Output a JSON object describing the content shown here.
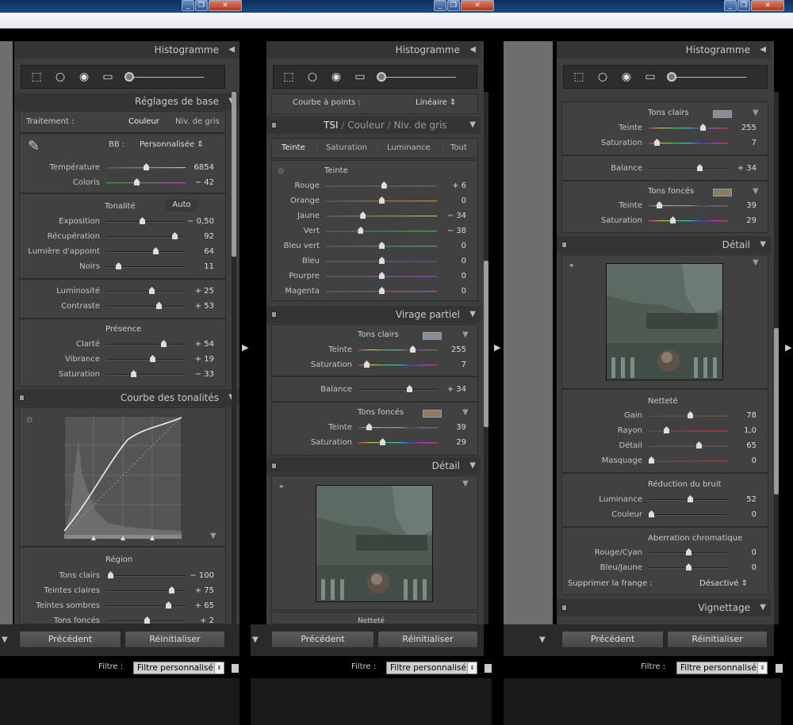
{
  "window": {
    "min": "_",
    "restore": "❐",
    "close": "✕"
  },
  "histogram": {
    "title": "Histogramme"
  },
  "panel1": {
    "basic": {
      "title": "Réglages de base",
      "traitement_label": "Traitement :",
      "couleur": "Couleur",
      "gris": "Niv. de gris",
      "bb_label": "BB :",
      "bb_value": "Personnalisée ⇕"
    },
    "wb": [
      {
        "label": "Température",
        "value": "6854",
        "pos": 0.5
      },
      {
        "label": "Coloris",
        "value": "− 42",
        "pos": 0.38
      }
    ],
    "tonalite": {
      "label": "Tonalité",
      "auto": "Auto"
    },
    "tone": [
      {
        "label": "Exposition",
        "value": "− 0,50",
        "pos": 0.45
      },
      {
        "label": "Récupération",
        "value": "92",
        "pos": 0.86
      },
      {
        "label": "Lumière d'appoint",
        "value": "64",
        "pos": 0.62
      },
      {
        "label": "Noirs",
        "value": "11",
        "pos": 0.15
      }
    ],
    "lum": [
      {
        "label": "Luminosité",
        "value": "+ 25",
        "pos": 0.57
      },
      {
        "label": "Contraste",
        "value": "+ 53",
        "pos": 0.66
      }
    ],
    "presence": {
      "label": "Présence"
    },
    "pres": [
      {
        "label": "Clarté",
        "value": "+ 54",
        "pos": 0.72
      },
      {
        "label": "Vibrance",
        "value": "+ 19",
        "pos": 0.58
      },
      {
        "label": "Saturation",
        "value": "− 33",
        "pos": 0.34
      }
    ],
    "curve": {
      "title": "Courbe des tonalités",
      "region": "Région"
    },
    "region": [
      {
        "label": "Tons clairs",
        "value": "− 100",
        "pos": 0.05
      },
      {
        "label": "Teintes claires",
        "value": "+ 75",
        "pos": 0.82
      },
      {
        "label": "Teintes sombres",
        "value": "+ 65",
        "pos": 0.78
      },
      {
        "label": "Tons foncés",
        "value": "+ 2",
        "pos": 0.51
      }
    ]
  },
  "panel2": {
    "courbe_label": "Courbe à points :",
    "courbe_value": "Linéaire ⇕",
    "hsl": {
      "tsi": "TSI",
      "couleur": "Couleur",
      "gris": "Niv. de gris"
    },
    "tabs": [
      "Teinte",
      "Saturation",
      "Luminance",
      "Tout"
    ],
    "teinte": "Teinte",
    "hue": [
      {
        "label": "Rouge",
        "value": "+ 6",
        "pos": 0.52,
        "c": "#c0392b"
      },
      {
        "label": "Orange",
        "value": "0",
        "pos": 0.5,
        "c": "#d9822b"
      },
      {
        "label": "Jaune",
        "value": "− 34",
        "pos": 0.33,
        "c": "#c8c23b"
      },
      {
        "label": "Vert",
        "value": "− 38",
        "pos": 0.31,
        "c": "#3fae4d"
      },
      {
        "label": "Bleu vert",
        "value": "0",
        "pos": 0.5,
        "c": "#2fa7a3"
      },
      {
        "label": "Bleu",
        "value": "0",
        "pos": 0.5,
        "c": "#3949c4"
      },
      {
        "label": "Pourpre",
        "value": "0",
        "pos": 0.5,
        "c": "#8c3ec4"
      },
      {
        "label": "Magenta",
        "value": "0",
        "pos": 0.5,
        "c": "#c43ea5"
      }
    ],
    "split": {
      "title": "Virage partiel",
      "tons_clairs": "Tons clairs",
      "tons_fonces": "Tons foncés",
      "balance": "Balance",
      "balance_value": "+ 34"
    },
    "hl": [
      {
        "label": "Teinte",
        "value": "255",
        "pos": 0.68
      },
      {
        "label": "Saturation",
        "value": "7",
        "pos": 0.1
      }
    ],
    "sh": [
      {
        "label": "Teinte",
        "value": "39",
        "pos": 0.13
      },
      {
        "label": "Saturation",
        "value": "29",
        "pos": 0.3
      }
    ],
    "detail": {
      "title": "Détail",
      "nettete": "Netteté"
    }
  },
  "panel3": {
    "split_hl": [
      {
        "label": "Teinte",
        "value": "255",
        "pos": 0.68
      },
      {
        "label": "Saturation",
        "value": "7",
        "pos": 0.1
      }
    ],
    "tons_clairs": "Tons clairs",
    "tons_fonces": "Tons foncés",
    "balance": "Balance",
    "balance_value": "+ 34",
    "split_sh": [
      {
        "label": "Teinte",
        "value": "39",
        "pos": 0.13
      },
      {
        "label": "Saturation",
        "value": "29",
        "pos": 0.3
      }
    ],
    "detail": {
      "title": "Détail",
      "nettete": "Netteté",
      "bruit": "Réduction du bruit",
      "aberr": "Aberration chromatique",
      "frange_label": "Supprimer la frange :",
      "frange_value": "Désactivé ⇕"
    },
    "sharp": [
      {
        "label": "Gain",
        "value": "78",
        "pos": 0.52
      },
      {
        "label": "Rayon",
        "value": "1,0",
        "pos": 0.22
      },
      {
        "label": "Détail",
        "value": "65",
        "pos": 0.63
      },
      {
        "label": "Masquage",
        "value": "0",
        "pos": 0.03
      }
    ],
    "noise": [
      {
        "label": "Luminance",
        "value": "52",
        "pos": 0.52
      },
      {
        "label": "Couleur",
        "value": "0",
        "pos": 0.03
      }
    ],
    "ca": [
      {
        "label": "Rouge/Cyan",
        "value": "0",
        "pos": 0.5
      },
      {
        "label": "Bleu/Jaune",
        "value": "0",
        "pos": 0.5
      }
    ],
    "vignette": {
      "title": "Vignettage"
    }
  },
  "buttons": {
    "prev": "Précédent",
    "reset": "Réinitialiser"
  },
  "filter": {
    "label": "Filtre :",
    "value": "Filtre personnalisé"
  },
  "colors": {
    "hl_swatch": "#8a8a98",
    "sh_swatch": "#8a7d60"
  }
}
